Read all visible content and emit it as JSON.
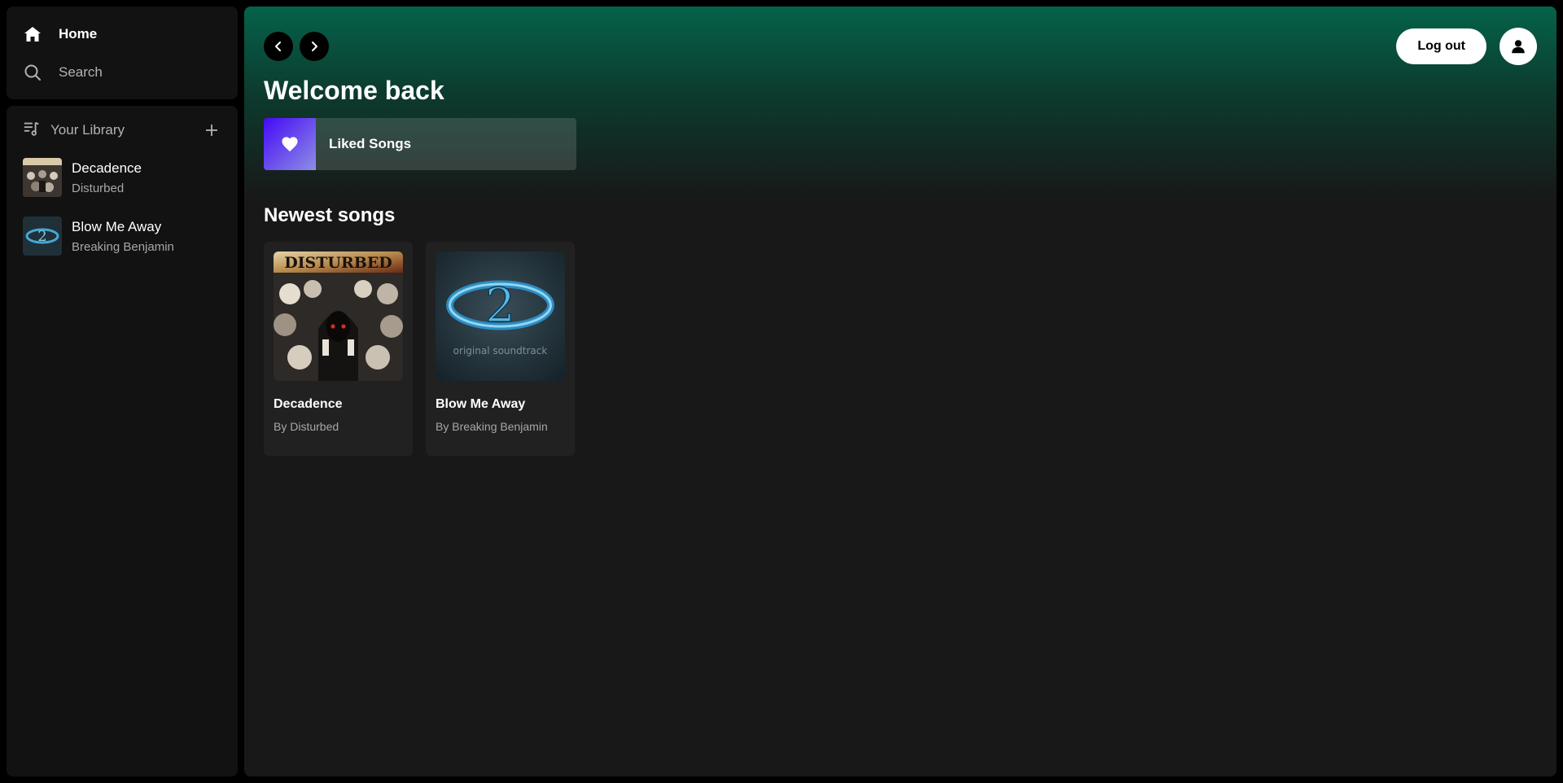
{
  "nav": {
    "home": "Home",
    "search": "Search"
  },
  "library": {
    "title": "Your Library",
    "items": [
      {
        "title": "Decadence",
        "artist": "Disturbed"
      },
      {
        "title": "Blow Me Away",
        "artist": "Breaking Benjamin"
      }
    ]
  },
  "header": {
    "logout": "Log out"
  },
  "main": {
    "welcome": "Welcome back",
    "liked": "Liked Songs",
    "section": "Newest songs",
    "cards": [
      {
        "title": "Decadence",
        "subtitle": "By Disturbed",
        "cover_text": "DISTURBED"
      },
      {
        "title": "Blow Me Away",
        "subtitle": "By Breaking Benjamin",
        "cover_text": "original soundtrack"
      }
    ]
  },
  "colors": {
    "accent_gradient_top": "#04634a",
    "surface": "#181818",
    "sidebar": "#121212"
  }
}
